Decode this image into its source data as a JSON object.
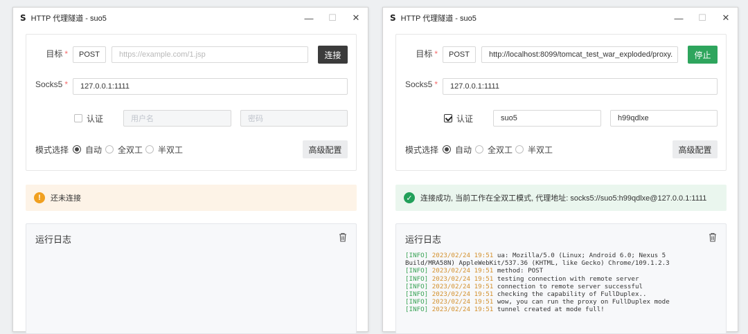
{
  "windows": [
    {
      "id": "left",
      "icon_glyph": "S",
      "title": "HTTP 代理隧道 - suo5",
      "controls": {
        "minimize": "—",
        "maximize": "☐",
        "close": "✕"
      },
      "target": {
        "label": "目标",
        "required_mark": "*",
        "method": "POST",
        "url_value": "",
        "url_placeholder": "https://example.com/1.jsp",
        "action_button": "连接",
        "action_style": "dark"
      },
      "socks5": {
        "label": "Socks5",
        "required_mark": "*",
        "value": "127.0.0.1:1111"
      },
      "auth": {
        "label": "认证",
        "checked": false,
        "username_value": "",
        "username_placeholder": "用户名",
        "password_value": "",
        "password_placeholder": "密码"
      },
      "mode": {
        "label": "模式选择",
        "options": [
          "自动",
          "全双工",
          "半双工"
        ],
        "selected": "自动"
      },
      "advanced_button": "高级配置",
      "status": {
        "kind": "warn",
        "icon": "!",
        "text": "还未连接"
      },
      "log": {
        "title": "运行日志",
        "lines": []
      }
    },
    {
      "id": "right",
      "icon_glyph": "S",
      "title": "HTTP 代理隧道 - suo5",
      "controls": {
        "minimize": "—",
        "maximize": "☐",
        "close": "✕"
      },
      "target": {
        "label": "目标",
        "required_mark": "*",
        "method": "POST",
        "url_value": "http://localhost:8099/tomcat_test_war_exploded/proxy.",
        "url_placeholder": "",
        "action_button": "停止",
        "action_style": "green"
      },
      "socks5": {
        "label": "Socks5",
        "required_mark": "*",
        "value": "127.0.0.1:1111"
      },
      "auth": {
        "label": "认证",
        "checked": true,
        "username_value": "suo5",
        "username_placeholder": "",
        "password_value": "h99qdlxe",
        "password_placeholder": ""
      },
      "mode": {
        "label": "模式选择",
        "options": [
          "自动",
          "全双工",
          "半双工"
        ],
        "selected": "自动"
      },
      "advanced_button": "高级配置",
      "status": {
        "kind": "ok",
        "icon": "✓",
        "text": "连接成功, 当前工作在全双工模式, 代理地址: socks5://suo5:h99qdlxe@127.0.0.1:1111"
      },
      "log": {
        "title": "运行日志",
        "lines": [
          {
            "level": "[INFO]",
            "time": "2023/02/24 19:51",
            "msg": "ua: Mozilla/5.0 (Linux; Android 6.0; Nexus 5"
          },
          {
            "level": "",
            "time": "",
            "msg": "Build/MRA58N) AppleWebKit/537.36 (KHTML, like Gecko) Chrome/109.1.2.3"
          },
          {
            "level": "[INFO]",
            "time": "2023/02/24 19:51",
            "msg": "method: POST"
          },
          {
            "level": "[INFO]",
            "time": "2023/02/24 19:51",
            "msg": "testing connection with remote server"
          },
          {
            "level": "[INFO]",
            "time": "2023/02/24 19:51",
            "msg": "connection to remote server successful"
          },
          {
            "level": "[INFO]",
            "time": "2023/02/24 19:51",
            "msg": "checking the capability of FullDuplex.."
          },
          {
            "level": "[INFO]",
            "time": "2023/02/24 19:51",
            "msg": "wow, you can run the proxy on FullDuplex mode"
          },
          {
            "level": "[INFO]",
            "time": "2023/02/24 19:51",
            "msg": "tunnel created at mode full!"
          }
        ]
      }
    }
  ]
}
